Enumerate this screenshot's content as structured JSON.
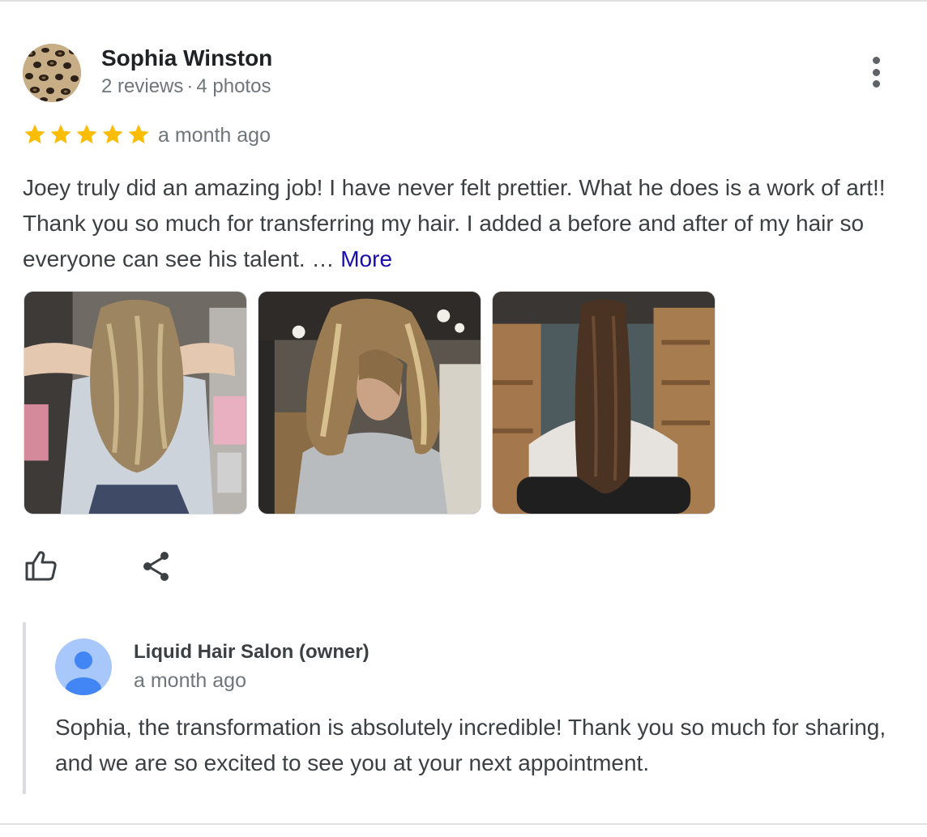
{
  "reviewer": {
    "name": "Sophia Winston",
    "reviews": "2 reviews",
    "separator": "·",
    "photos": "4 photos",
    "avatar_icon": "leopard-print-avatar"
  },
  "review": {
    "rating": 5,
    "rating_max": 5,
    "star_color": "#fbbc04",
    "date": "a month ago",
    "text": "Joey truly did an amazing job! I have never felt prettier. What he does is a work of art!! Thank you so much for transferring my hair. I added a before and after of my hair so everyone can see his talent. …",
    "more_label": "More",
    "link_color": "#1a0dab"
  },
  "photos": [
    {
      "icon": "photo-hair-back-arms-raised"
    },
    {
      "icon": "photo-hair-front-wavy"
    },
    {
      "icon": "photo-hair-back-straight"
    }
  ],
  "actions": {
    "like_icon": "thumbs-up-icon",
    "share_icon": "share-icon",
    "menu_icon": "more-vertical-icon"
  },
  "owner_reply": {
    "name": "Liquid Hair Salon (owner)",
    "date": "a month ago",
    "text": "Sophia, the transformation is absolutely incredible! Thank you so much for sharing, and we are so excited to see you at your next appointment.",
    "avatar_icon": "default-user-avatar",
    "avatar_color": "#a8c7fa",
    "avatar_figure_color": "#4285f4"
  }
}
